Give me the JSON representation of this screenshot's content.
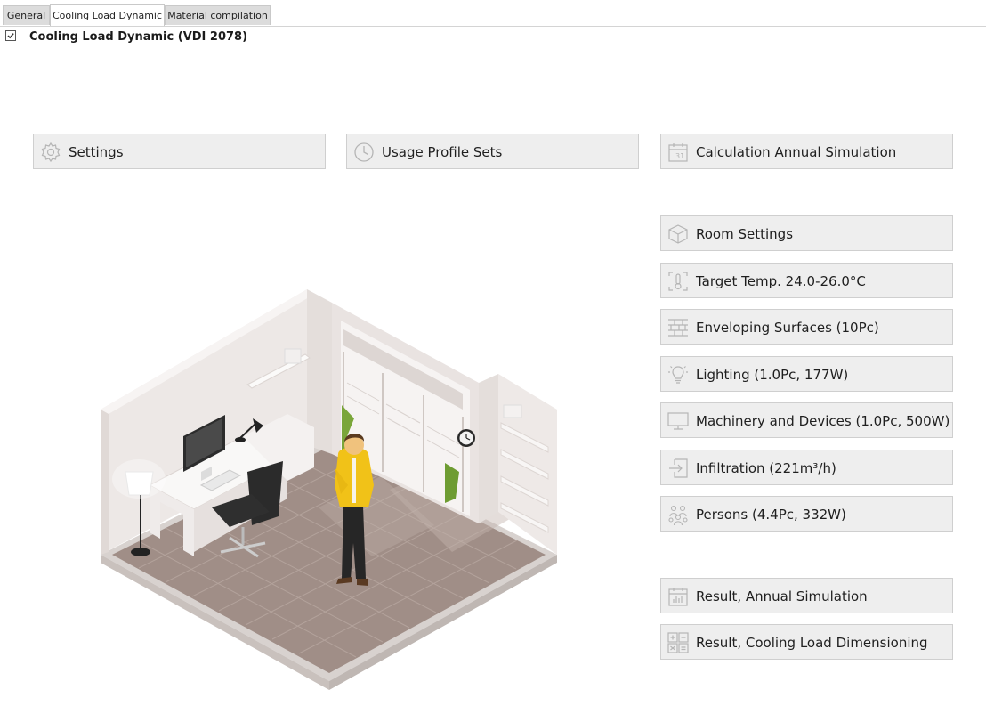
{
  "tabs": [
    {
      "label": "General",
      "active": false
    },
    {
      "label": "Cooling Load Dynamic",
      "active": true
    },
    {
      "label": "Material compilation",
      "active": false
    }
  ],
  "header": {
    "checked": true,
    "title": "Cooling Load Dynamic (VDI 2078)"
  },
  "top_buttons": {
    "settings": {
      "label": "Settings",
      "icon": "gear-icon"
    },
    "usage_profile_sets": {
      "label": "Usage Profile Sets",
      "icon": "clock-icon"
    },
    "calculation_annual_simulation": {
      "label": "Calculation Annual Simulation",
      "icon": "calendar-icon"
    }
  },
  "room_buttons": {
    "room_settings": {
      "label": "Room Settings",
      "icon": "cube-icon"
    },
    "target_temp": {
      "label": "Target Temp. 24.0-26.0°C",
      "icon": "thermometer-icon"
    },
    "enveloping_surfaces": {
      "label": "Enveloping Surfaces (10Pc)",
      "icon": "brick-wall-icon"
    },
    "lighting": {
      "label": "Lighting (1.0Pc, 177W)",
      "icon": "lightbulb-icon"
    },
    "machinery": {
      "label": "Machinery and Devices (1.0Pc, 500W)",
      "icon": "monitor-icon"
    },
    "infiltration": {
      "label": "Infiltration (221m³/h)",
      "icon": "arrow-in-icon"
    },
    "persons": {
      "label": "Persons (4.4Pc, 332W)",
      "icon": "persons-icon"
    }
  },
  "result_buttons": {
    "annual_simulation": {
      "label": "Result, Annual Simulation",
      "icon": "bar-chart-icon"
    },
    "cooling_load_dimensioning": {
      "label": "Result, Cooling Load Dimensioning",
      "icon": "calculator-icon"
    }
  },
  "colors": {
    "button_bg": "#eeeeee",
    "button_border": "#cfcfcf",
    "icon_stroke": "#b5b5b5",
    "tab_bg": "#dcdcdc",
    "floor": "#a08e87",
    "wall": "#ece6e4",
    "shirt": "#f1c218"
  }
}
